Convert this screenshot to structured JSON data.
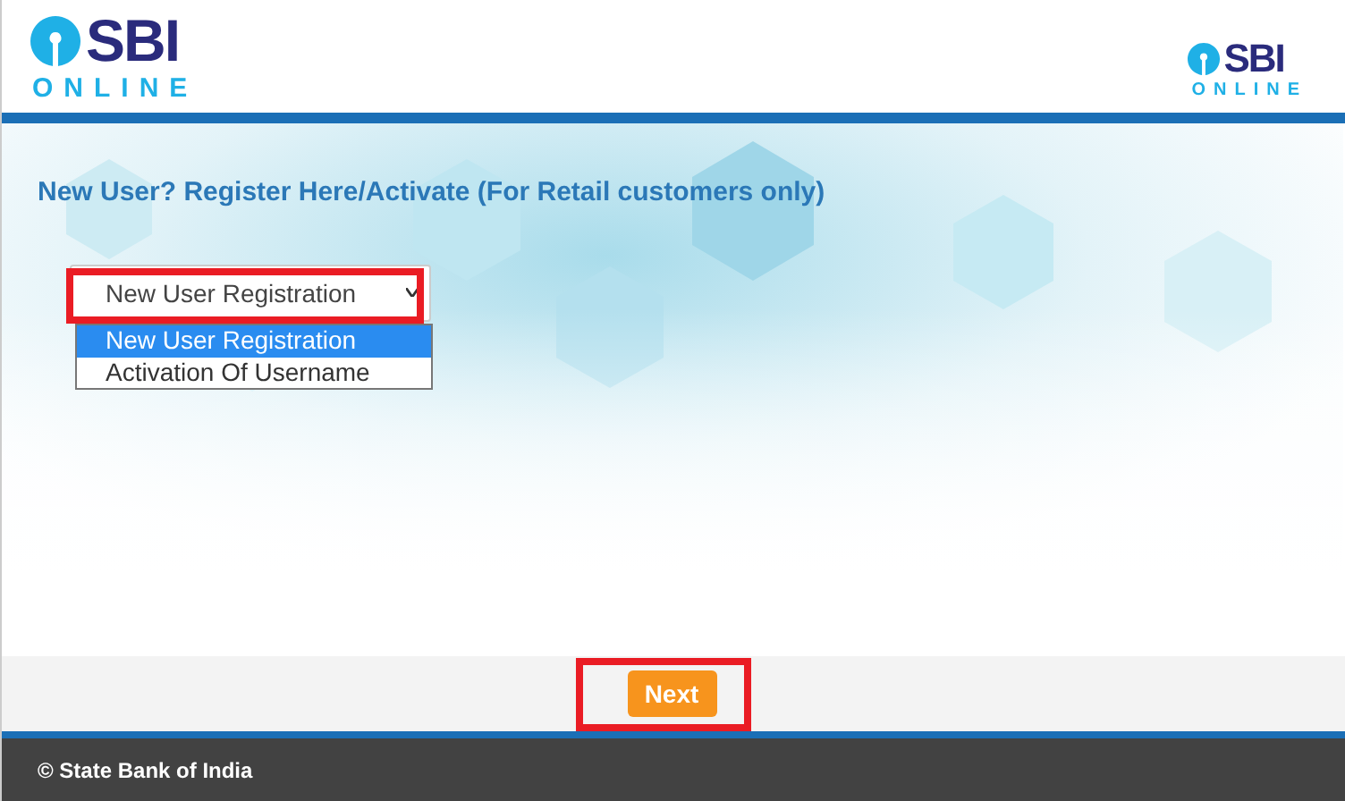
{
  "header": {
    "logo_left": {
      "brand": "SBI",
      "tagline": "ONLINE"
    },
    "logo_right": {
      "brand": "SBI",
      "tagline": "ONLINE"
    }
  },
  "heading": "New User? Register Here/Activate (For Retail customers only)",
  "dropdown": {
    "value": "New User Registration",
    "highlighted": true,
    "expanded": true,
    "options": [
      {
        "label": "New User Registration",
        "selected": true
      },
      {
        "label": "Activation Of Username",
        "selected": false
      }
    ]
  },
  "next_button": {
    "label": "Next",
    "highlighted": true
  },
  "footer": {
    "text": "© State Bank of India"
  }
}
